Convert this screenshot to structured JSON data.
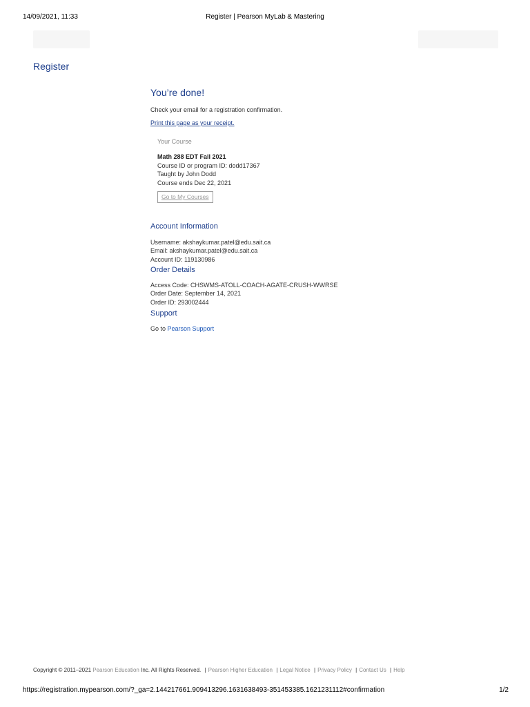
{
  "print_header": {
    "datetime": "14/09/2021, 11:33",
    "title": "Register | Pearson MyLab & Mastering"
  },
  "page": {
    "heading": "Register"
  },
  "confirmation": {
    "title": "You’re done!",
    "email_note": "Check your email for a registration confirmation.",
    "print_link": "Print this page as your receipt."
  },
  "course": {
    "label": "Your Course",
    "name": "Math 288 EDT Fall 2021",
    "course_id": "Course ID or program ID: dodd17367",
    "taught_by": "Taught by John Dodd",
    "ends": "Course ends Dec 22, 2021",
    "button": "Go to My Courses"
  },
  "account": {
    "title": "Account Information",
    "username": "Username: akshaykumar.patel@edu.sait.ca",
    "email": "Email: akshaykumar.patel@edu.sait.ca",
    "account_id": "Account ID: 119130986"
  },
  "order": {
    "title": "Order Details",
    "access_code": "Access Code: CHSWMS-ATOLL-COACH-AGATE-CRUSH-WWRSE",
    "order_date": "Order Date: September 14, 2021",
    "order_id": "Order ID: 293002444"
  },
  "support": {
    "title": "Support",
    "prefix": "Go to",
    "link": "Pearson Support"
  },
  "footer": {
    "copyright": "Copyright © 2011–2021",
    "company": "Pearson Education",
    "rights": "Inc. All Rights Reserved.",
    "links": [
      "Pearson Higher Education",
      "Legal Notice",
      "Privacy Policy",
      "Contact Us",
      "Help"
    ]
  },
  "print_footer": {
    "url": "https://registration.mypearson.com/?_ga=2.144217661.909413296.1631638493-351453385.1621231112#confirmation",
    "page": "1/2"
  },
  "colors": {
    "heading_blue": "#1e3f8c",
    "link_blue": "#1a56b8"
  }
}
